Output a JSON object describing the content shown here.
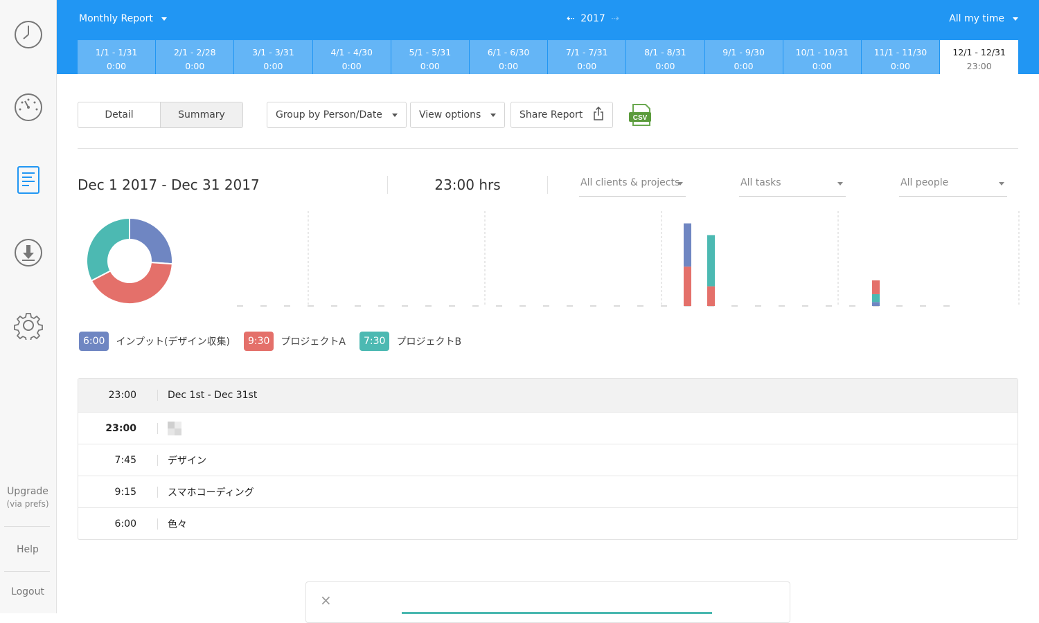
{
  "sidebar": {
    "icons": [
      "clock-icon",
      "dashboard-gauge-icon",
      "report-document-icon",
      "download-icon",
      "settings-gear-icon"
    ],
    "upgrade_label": "Upgrade",
    "upgrade_sub": "(via prefs)",
    "help_label": "Help",
    "logout_label": "Logout"
  },
  "header": {
    "report_type": "Monthly Report",
    "year": "2017",
    "time_scope": "All my time",
    "months": [
      {
        "range": "1/1 - 1/31",
        "value": "0:00"
      },
      {
        "range": "2/1 - 2/28",
        "value": "0:00"
      },
      {
        "range": "3/1 - 3/31",
        "value": "0:00"
      },
      {
        "range": "4/1 - 4/30",
        "value": "0:00"
      },
      {
        "range": "5/1 - 5/31",
        "value": "0:00"
      },
      {
        "range": "6/1 - 6/30",
        "value": "0:00"
      },
      {
        "range": "7/1 - 7/31",
        "value": "0:00"
      },
      {
        "range": "8/1 - 8/31",
        "value": "0:00"
      },
      {
        "range": "9/1 - 9/30",
        "value": "0:00"
      },
      {
        "range": "10/1 - 10/31",
        "value": "0:00"
      },
      {
        "range": "11/1 - 11/30",
        "value": "0:00"
      },
      {
        "range": "12/1 - 12/31",
        "value": "23:00",
        "active": true
      }
    ]
  },
  "toolbar": {
    "detail_label": "Detail",
    "summary_label": "Summary",
    "group_by_label": "Group by Person/Date",
    "view_options_label": "View options",
    "share_label": "Share Report",
    "csv_label": "CSV"
  },
  "summary": {
    "date_range": "Dec 1 2017 - Dec 31 2017",
    "total_hours": "23:00 hrs",
    "filter_clients": "All clients & projects",
    "filter_tasks": "All tasks",
    "filter_people": "All people"
  },
  "colors": {
    "primary": "#2196f3",
    "input": "#6f86c2",
    "project_a": "#e4706a",
    "project_b": "#4cb9b2"
  },
  "chart_data": {
    "type": "bar",
    "donut": [
      {
        "name": "インプット(デザイン収集)",
        "value": 6.0,
        "color": "#6f86c2"
      },
      {
        "name": "プロジェクトA",
        "value": 9.5,
        "color": "#e4706a"
      },
      {
        "name": "プロジェクトB",
        "value": 7.5,
        "color": "#4cb9b2"
      }
    ],
    "days": 31,
    "stacked_bars": [
      {
        "day": 20,
        "segments": [
          {
            "series": "プロジェクトA",
            "value": 5.0
          },
          {
            "series": "インプット(デザイン収集)",
            "value": 5.5
          }
        ]
      },
      {
        "day": 21,
        "segments": [
          {
            "series": "プロジェクトA",
            "value": 2.5
          },
          {
            "series": "プロジェクトB",
            "value": 6.5
          }
        ]
      },
      {
        "day": 28,
        "segments": [
          {
            "series": "インプット(デザイン収集)",
            "value": 0.5
          },
          {
            "series": "プロジェクトB",
            "value": 1.0
          },
          {
            "series": "プロジェクトA",
            "value": 1.75
          }
        ]
      }
    ],
    "ymax": 11
  },
  "legend": [
    {
      "value": "6:00",
      "label": "インプット(デザイン収集)",
      "color": "#6f86c2"
    },
    {
      "value": "9:30",
      "label": "プロジェクトA",
      "color": "#e4706a"
    },
    {
      "value": "7:30",
      "label": "プロジェクトB",
      "color": "#4cb9b2"
    }
  ],
  "table": {
    "rows": [
      {
        "time": "23:00",
        "name": "Dec 1st - Dec 31st",
        "kind": "header"
      },
      {
        "time": "23:00",
        "name": "",
        "kind": "person"
      },
      {
        "time": "7:45",
        "name": "デザイン",
        "kind": "task"
      },
      {
        "time": "9:15",
        "name": "スマホコーディング",
        "kind": "task"
      },
      {
        "time": "6:00",
        "name": "色々",
        "kind": "task"
      }
    ]
  },
  "panel": {
    "close_icon": "close-icon"
  }
}
